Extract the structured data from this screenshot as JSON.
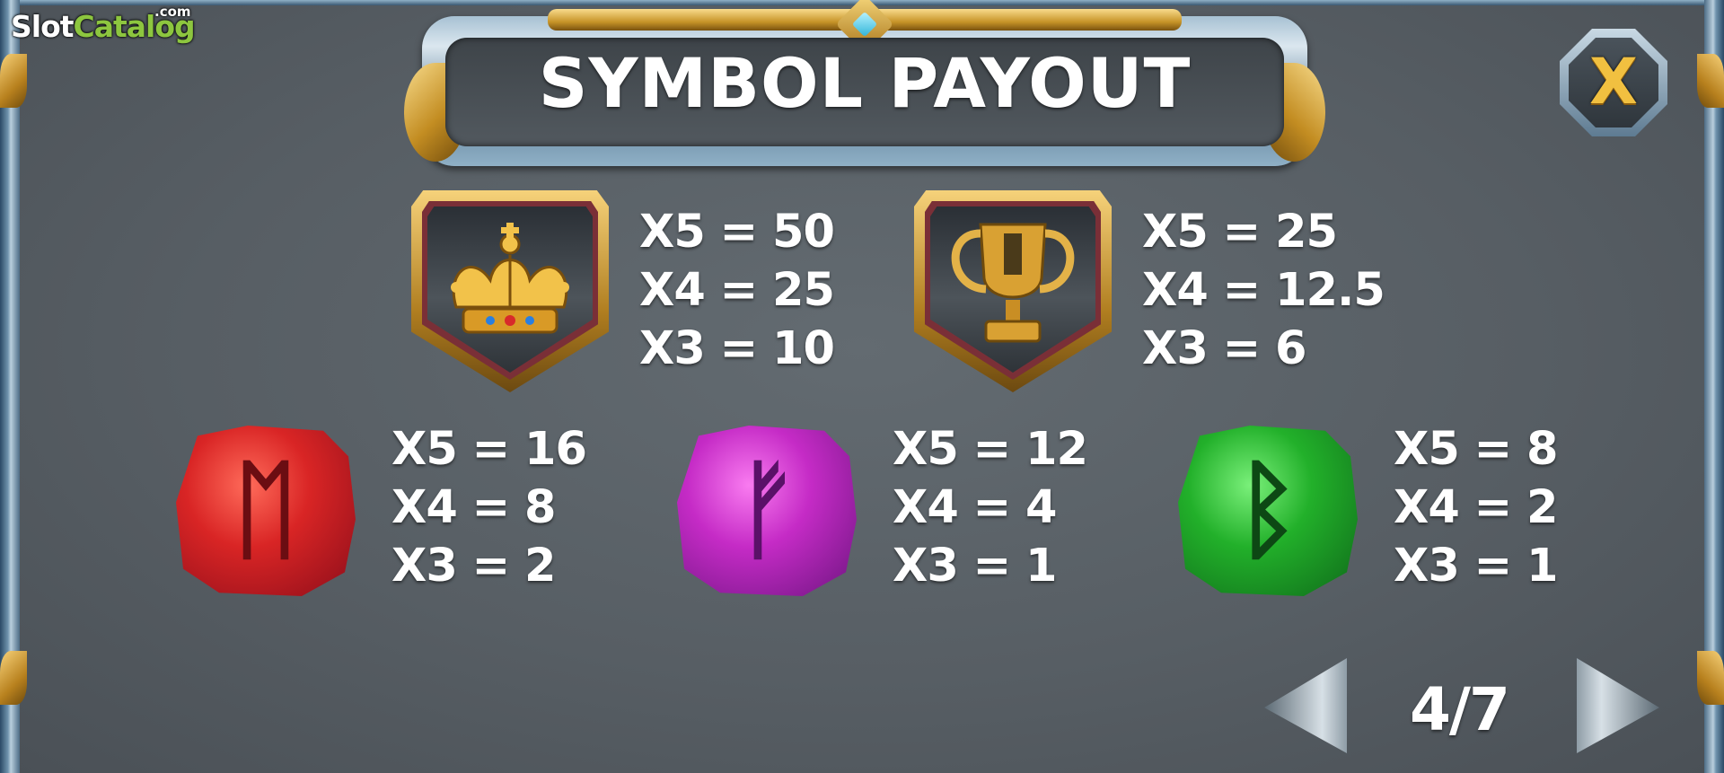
{
  "watermark": {
    "slot": "Slot",
    "catalog": "Catalog",
    "dotcom": ".com"
  },
  "title": "SYMBOL PAYOUT",
  "close_label": "X",
  "symbols": [
    {
      "name": "crown",
      "rune": "",
      "payouts": [
        "X5 = 50",
        "X4 = 25",
        "X3 = 10"
      ]
    },
    {
      "name": "trophy",
      "rune": "",
      "payouts": [
        "X5 = 25",
        "X4 = 12.5",
        "X3 = 6"
      ]
    },
    {
      "name": "red-rune-gem",
      "rune": "ᛖ",
      "payouts": [
        "X5 = 16",
        "X4 = 8",
        "X3 = 2"
      ]
    },
    {
      "name": "purple-rune-gem",
      "rune": "ᚠ",
      "payouts": [
        "X5 = 12",
        "X4 = 4",
        "X3 = 1"
      ]
    },
    {
      "name": "green-rune-gem",
      "rune": "ᛒ",
      "payouts": [
        "X5 = 8",
        "X4 = 2",
        "X3 = 1"
      ]
    }
  ],
  "pagination": {
    "current": "4/7"
  },
  "colors": {
    "gold": "#f1c040",
    "background": "#5c6369",
    "logo_green": "#8dc63f"
  }
}
